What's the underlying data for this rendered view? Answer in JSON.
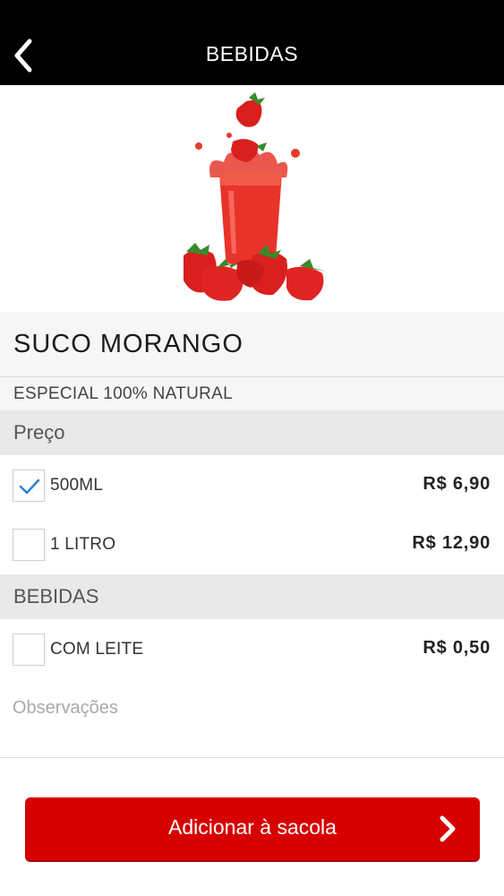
{
  "header": {
    "title": "BEBIDAS",
    "back_icon": "chevron-left-icon"
  },
  "product": {
    "image": "strawberry-juice-image",
    "name": "SUCO MORANGO",
    "description": "ESPECIAL 100% NATURAL"
  },
  "sections": {
    "price": {
      "title": "Preço",
      "options": [
        {
          "label": "500ML",
          "price": "R$ 6,90",
          "checked": true
        },
        {
          "label": "1 LITRO",
          "price": "R$ 12,90",
          "checked": false
        }
      ]
    },
    "extras": {
      "title": "BEBIDAS",
      "options": [
        {
          "label": "COM LEITE",
          "price": "R$ 0,50",
          "checked": false
        }
      ]
    }
  },
  "notes": {
    "placeholder": "Observações"
  },
  "cta": {
    "label": "Adicionar à sacola",
    "icon": "chevron-right-icon"
  },
  "colors": {
    "header_bg": "#000000",
    "accent_red": "#d60000",
    "check_blue": "#2f7fd1"
  }
}
